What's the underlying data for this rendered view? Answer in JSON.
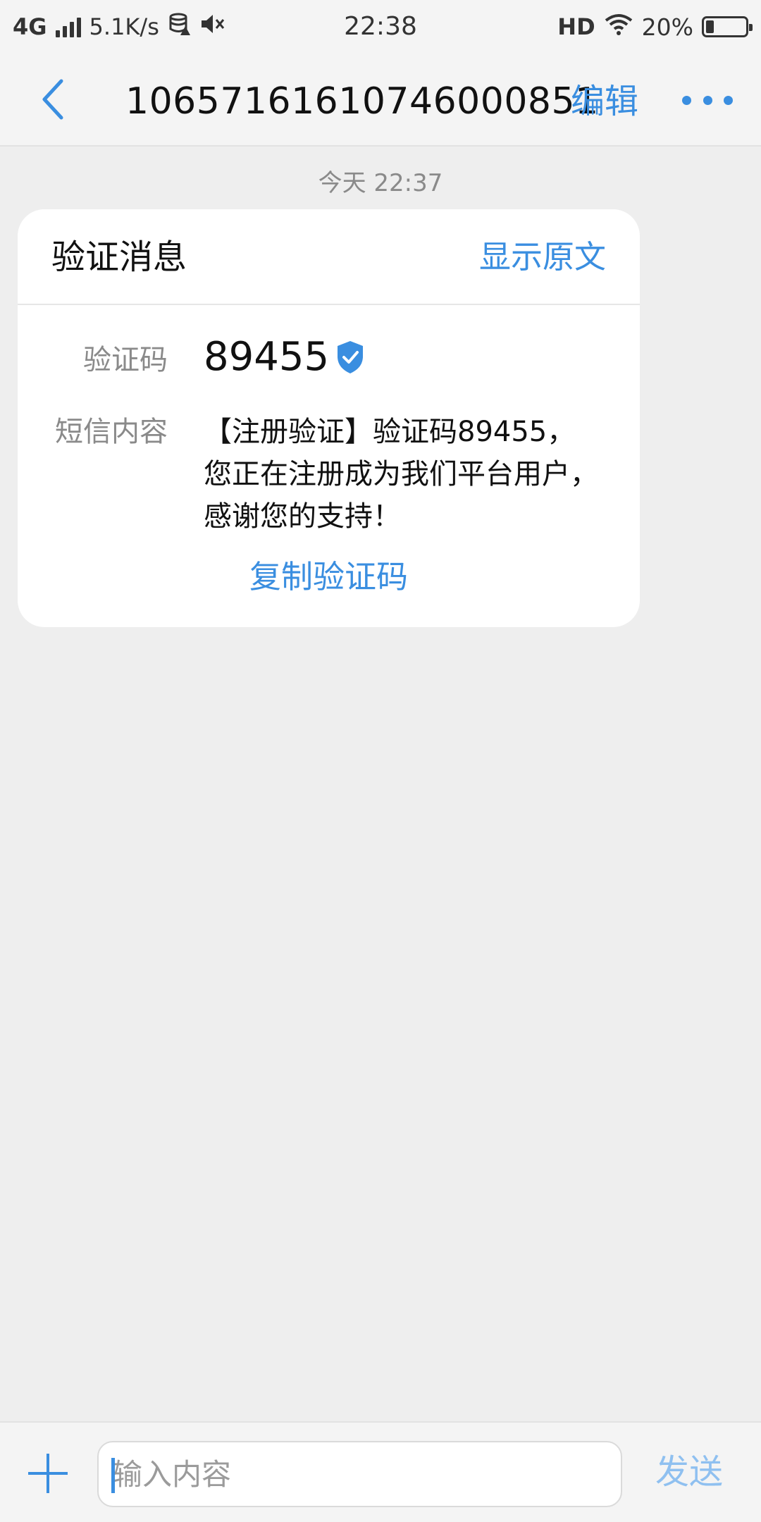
{
  "status_bar": {
    "network": "4G",
    "speed": "5.1K/s",
    "time": "22:38",
    "hd": "HD",
    "battery": "20%",
    "battery_level": 0.2,
    "icons": [
      "signal-icon",
      "data-saver-icon",
      "mute-icon",
      "wifi-icon",
      "battery-icon"
    ]
  },
  "header": {
    "title": "10657161610746000851",
    "edit_label": "编辑",
    "back_icon": "chevron-left-icon",
    "more_icon": "more-dots-icon"
  },
  "conversation": {
    "timestamp": "今天 22:37"
  },
  "card": {
    "title": "验证消息",
    "show_original": "显示原文",
    "code_label": "验证码",
    "code_value": "89455",
    "verified_icon": "verified-shield-icon",
    "content_label": "短信内容",
    "content": "【注册验证】验证码89455，您正在注册成为我们平台用户，感谢您的支持！",
    "copy_button": "复制验证码"
  },
  "input_bar": {
    "add_icon": "plus-icon",
    "placeholder": "输入内容",
    "send_label": "发送"
  },
  "colors": {
    "accent": "#3a8ee0",
    "send_disabled": "#8fc0f0",
    "background": "#eeeeee",
    "card": "#ffffff"
  }
}
